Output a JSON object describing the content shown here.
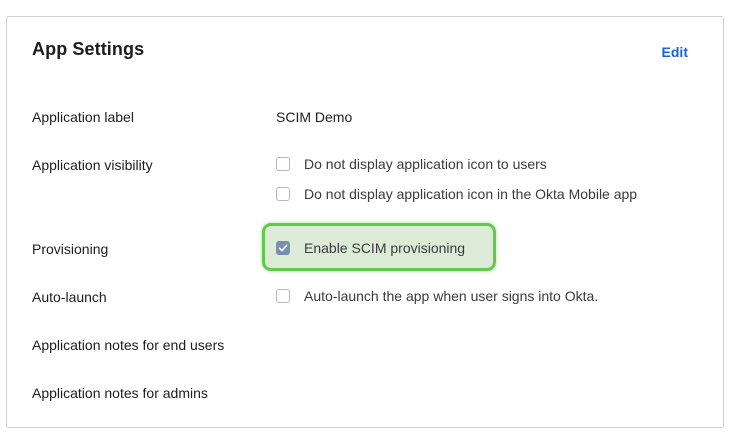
{
  "panel": {
    "title": "App Settings",
    "edit_label": "Edit"
  },
  "rows": {
    "app_label": {
      "label": "Application label",
      "value": "SCIM Demo"
    },
    "visibility": {
      "label": "Application visibility",
      "options": [
        {
          "label": "Do not display application icon to users",
          "checked": false
        },
        {
          "label": "Do not display application icon in the Okta Mobile app",
          "checked": false
        }
      ]
    },
    "provisioning": {
      "label": "Provisioning",
      "option": {
        "label": "Enable SCIM provisioning",
        "checked": true
      }
    },
    "auto_launch": {
      "label": "Auto-launch",
      "option": {
        "label": "Auto-launch the app when user signs into Okta.",
        "checked": false
      }
    },
    "notes_end_users": {
      "label": "Application notes for end users"
    },
    "notes_admins": {
      "label": "Application notes for admins"
    }
  },
  "colors": {
    "accent_link": "#1662dd",
    "highlight_border": "#63c94e",
    "highlight_fill": "#dbebd6",
    "checked_fill": "#7a8fb0"
  }
}
